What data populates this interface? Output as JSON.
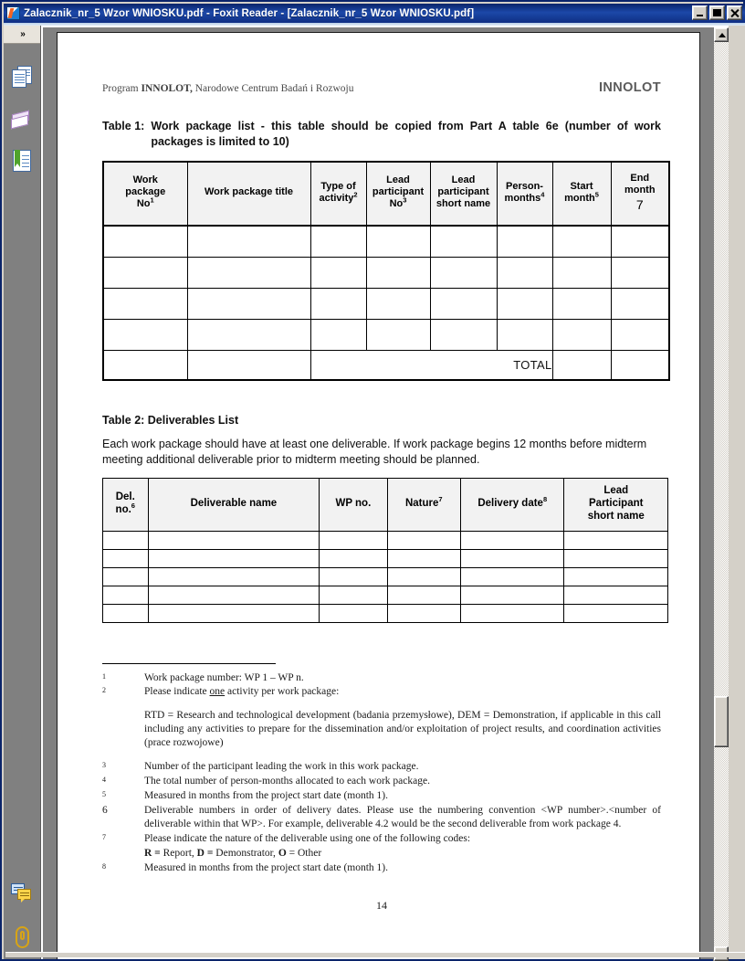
{
  "window": {
    "title": "Zalacznik_nr_5  Wzor WNIOSKU.pdf - Foxit Reader - [Zalacznik_nr_5  Wzor WNIOSKU.pdf]",
    "app_icon": "foxit-icon",
    "minimize_label": "Minimize",
    "maximize_label": "Maximize",
    "close_label": "Close"
  },
  "navpane": {
    "toggle_label": "»",
    "items": [
      {
        "name": "pages-panel",
        "icon": "pages-icon"
      },
      {
        "name": "layers-panel",
        "icon": "layers-icon"
      },
      {
        "name": "bookmarks-panel",
        "icon": "bookmark-document-icon"
      },
      {
        "name": "comments-panel",
        "icon": "comments-icon"
      },
      {
        "name": "attachments-panel",
        "icon": "paperclip-icon"
      }
    ]
  },
  "scrollbar": {
    "up_label": "Scroll up",
    "down_label": "Scroll down",
    "thumb_label": "Vertical scroll thumb"
  },
  "document": {
    "running_head_left_prefix": "Program ",
    "running_head_left_bold": "INNOLOT,",
    "running_head_left_rest": " Narodowe Centrum Badań i Rozwoju",
    "running_head_right": "INNOLOT",
    "page_number": "14",
    "table1": {
      "caption_label": "Table 1:",
      "caption_text": "Work package list - this table should be copied from Part A table 6e (number of work packages is limited to 10)",
      "headers": [
        {
          "line1": "Work",
          "line2": "package",
          "line3": "No",
          "sup": "1"
        },
        {
          "line1": "Work package title",
          "line2": "",
          "line3": "",
          "sup": ""
        },
        {
          "line1": "Type of",
          "line2": "activity",
          "line3": "",
          "sup": "2"
        },
        {
          "line1": "Lead",
          "line2": "participant",
          "line3": "No",
          "sup": "3"
        },
        {
          "line1": "Lead",
          "line2": "participant",
          "line3": "short name",
          "sup": ""
        },
        {
          "line1": "Person-",
          "line2": "months",
          "line3": "",
          "sup": "4"
        },
        {
          "line1": "Start",
          "line2": "month",
          "line3": "",
          "sup": "5"
        },
        {
          "line1": "End",
          "line2": "month",
          "line3": "7",
          "sup": ""
        }
      ],
      "rows": [
        [
          "",
          "",
          "",
          "",
          "",
          "",
          "",
          ""
        ],
        [
          "",
          "",
          "",
          "",
          "",
          "",
          "",
          ""
        ],
        [
          "",
          "",
          "",
          "",
          "",
          "",
          "",
          ""
        ],
        [
          "",
          "",
          "",
          "",
          "",
          "",
          "",
          ""
        ]
      ],
      "total_label": "TOTAL",
      "total_value": ""
    },
    "table2": {
      "caption": "Table 2: Deliverables List",
      "intro": "Each work package should have at least one deliverable. If work package begins 12 months before midterm meeting additional deliverable prior to midterm meeting should be planned.",
      "headers": [
        {
          "line1": "Del.",
          "line2": "no.",
          "line3": "",
          "sup": "6"
        },
        {
          "line1": "Deliverable name",
          "line2": "",
          "line3": "",
          "sup": ""
        },
        {
          "line1": "WP no.",
          "line2": "",
          "line3": "",
          "sup": ""
        },
        {
          "line1": "Nature",
          "line2": "",
          "line3": "",
          "sup": "7"
        },
        {
          "line1": "Delivery date",
          "line2": "",
          "line3": "",
          "sup": "8"
        },
        {
          "line1": "Lead",
          "line2": "Participant",
          "line3": "short name",
          "sup": ""
        }
      ],
      "rows": [
        [
          "",
          "",
          "",
          "",
          "",
          ""
        ],
        [
          "",
          "",
          "",
          "",
          "",
          ""
        ],
        [
          "",
          "",
          "",
          "",
          "",
          ""
        ],
        [
          "",
          "",
          "",
          "",
          "",
          ""
        ],
        [
          "",
          "",
          "",
          "",
          "",
          ""
        ]
      ]
    },
    "footnotes": [
      {
        "marker": "1",
        "style": "sup",
        "text": "Work package number: WP 1 – WP n."
      },
      {
        "marker": "2",
        "style": "sup",
        "text": "Please indicate one activity per work package:"
      },
      {
        "marker": "",
        "style": "sup",
        "text": "RTD = Research and technological development (badania przemysłowe), DEM = Demonstration, if applicable in this call including any activities to prepare for the dissemination and/or exploitation of project results, and coordination activities (prace rozwojowe)"
      },
      {
        "marker": "3",
        "style": "sup",
        "text": "Number of the participant leading the work in this work package."
      },
      {
        "marker": "4",
        "style": "sup",
        "text": "The total number of person-months allocated to each work package."
      },
      {
        "marker": "5",
        "style": "sup",
        "text": "Measured in months from the project start date (month 1)."
      },
      {
        "marker": "6",
        "style": "plain",
        "text": "Deliverable numbers in order of delivery dates. Please use the numbering convention <WP number>.<number of deliverable within that WP>. For example, deliverable 4.2 would be the second deliverable from work package 4."
      },
      {
        "marker": "7",
        "style": "sup",
        "text": "Please indicate the nature of the deliverable using one of the following codes:"
      },
      {
        "marker": "",
        "style": "sup",
        "text": "R =  Report, D =  Demonstrator, O = Other"
      },
      {
        "marker": "8",
        "style": "sup",
        "text": "Measured in months from the project start date (month 1)."
      }
    ]
  },
  "colors": {
    "titlebar": "#0a246a",
    "chrome": "#d4d0c8",
    "page_bg": "#ffffff",
    "viewer_bg": "#808080",
    "header_cell": "#f2f2f2",
    "total_gray": "#9e9e9e",
    "total_lightgray": "#e0e0e0"
  }
}
